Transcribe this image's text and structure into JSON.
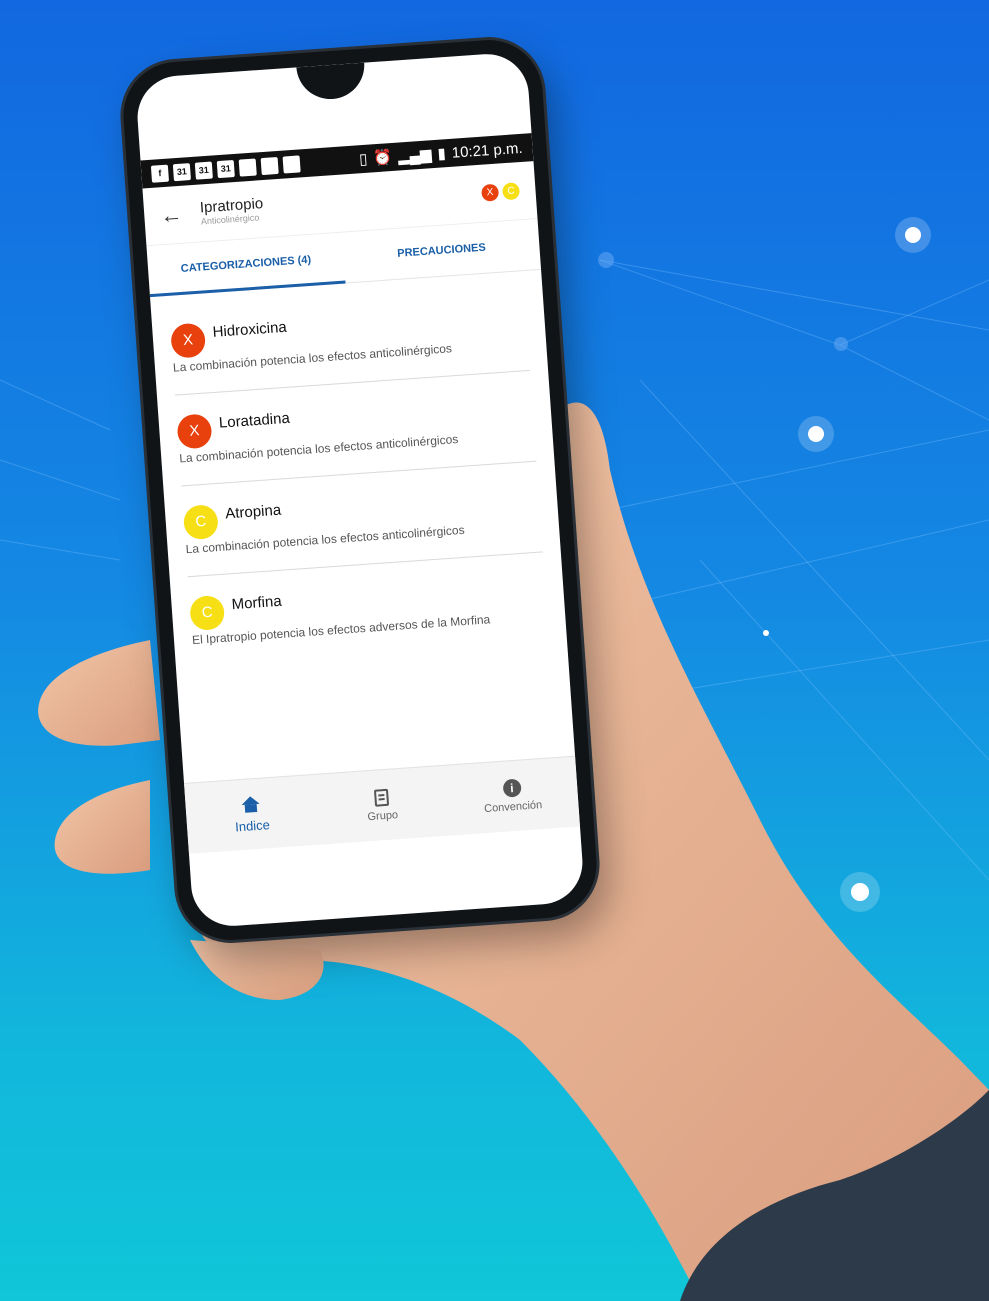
{
  "colors": {
    "x_badge": "#e8410e",
    "c_badge": "#f7df16",
    "accent": "#1a5fa8"
  },
  "statusbar": {
    "time": "10:21 p.m.",
    "calendar_day": "31",
    "app_icon": "facebook-icon"
  },
  "appbar": {
    "title": "Ipratropio",
    "subtitle": "Anticolinérgico",
    "badges": [
      "X",
      "C"
    ]
  },
  "tabs": [
    {
      "label": "CATEGORIZACIONES (4)",
      "active": true
    },
    {
      "label": "PRECAUCIONES",
      "active": false
    }
  ],
  "items": [
    {
      "badge": "X",
      "name": "Hidroxicina",
      "description": "La combinación potencia los efectos anticolinérgicos"
    },
    {
      "badge": "X",
      "name": "Loratadina",
      "description": "La combinación potencia los efectos anticolinérgicos"
    },
    {
      "badge": "C",
      "name": "Atropina",
      "description": "La combinación potencia los efectos anticolinérgicos"
    },
    {
      "badge": "C",
      "name": "Morfina",
      "description": "El Ipratropio potencia los efectos adversos de la Morfina"
    }
  ],
  "bottomnav": [
    {
      "label": "Indice",
      "icon": "home-icon",
      "active": true
    },
    {
      "label": "Grupo",
      "icon": "document-icon",
      "active": false
    },
    {
      "label": "Convención",
      "icon": "info-icon",
      "active": false
    }
  ]
}
